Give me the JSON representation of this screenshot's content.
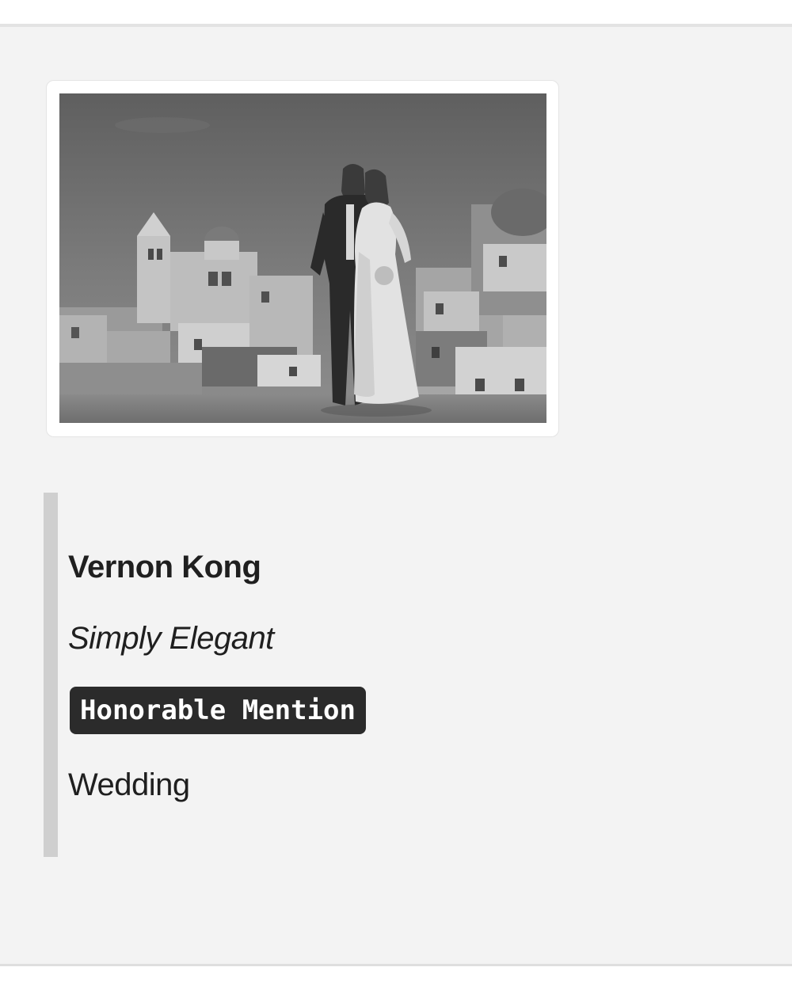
{
  "entry": {
    "photographer": "Vernon Kong",
    "title": "Simply Elegant",
    "award": "Honorable Mention",
    "category": "Wedding"
  },
  "colors": {
    "panel_background": "#f3f3f3",
    "quote_bar": "#cfcfcf",
    "award_badge_background": "#2b2b2b",
    "award_badge_text": "#ffffff",
    "text": "#1f1f1f"
  }
}
